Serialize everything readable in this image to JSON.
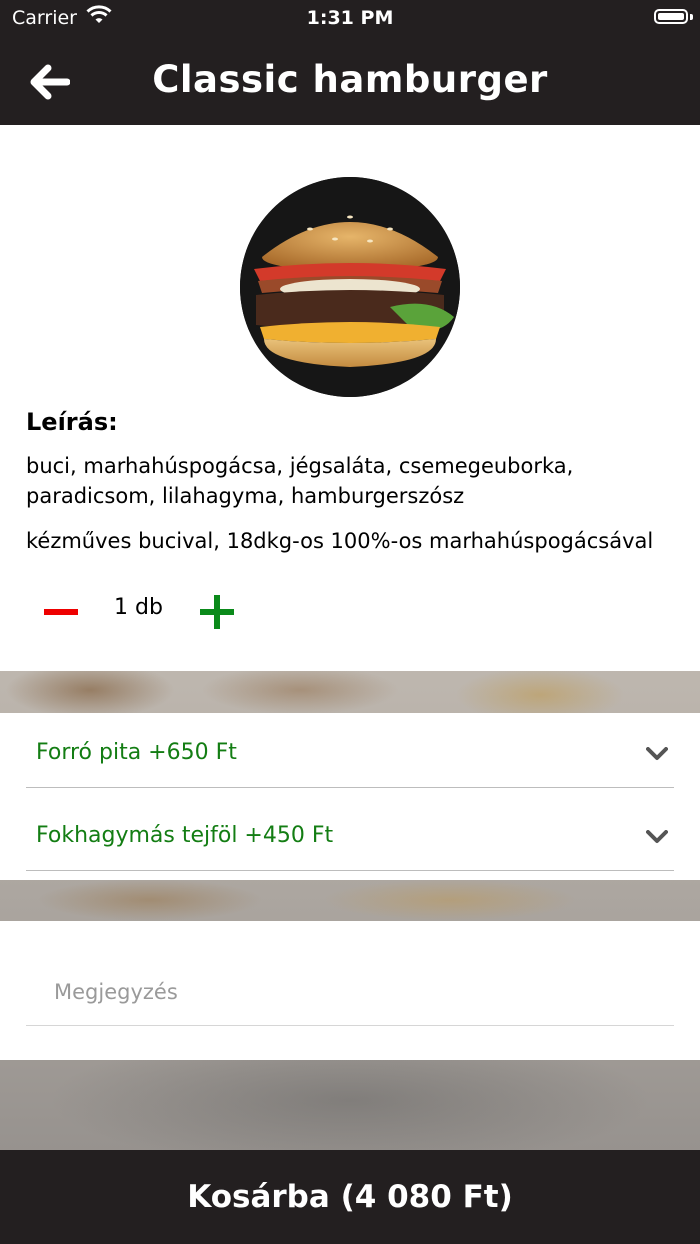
{
  "status_bar": {
    "carrier": "Carrier",
    "time": "1:31 PM"
  },
  "nav": {
    "title": "Classic hamburger",
    "back_icon": "arrow-left-icon"
  },
  "product": {
    "description_title": "Leírás:",
    "description": "buci, marhahúspogácsa, jégsaláta, csemegeuborka, paradicsom, lilahagyma, hamburgerszósz",
    "description2": "kézműves bucival, 18dkg-os 100%-os marhahúspogácsával",
    "quantity": "1 db"
  },
  "options": [
    {
      "label": "Forró pita +650 Ft"
    },
    {
      "label": "Fokhagymás tejföl +450 Ft"
    }
  ],
  "note": {
    "placeholder": "Megjegyzés"
  },
  "cart": {
    "label": "Kosárba (4 080 Ft)"
  },
  "colors": {
    "bar": "#231f20",
    "accent_green": "#137d13",
    "minus_red": "#e00000"
  }
}
